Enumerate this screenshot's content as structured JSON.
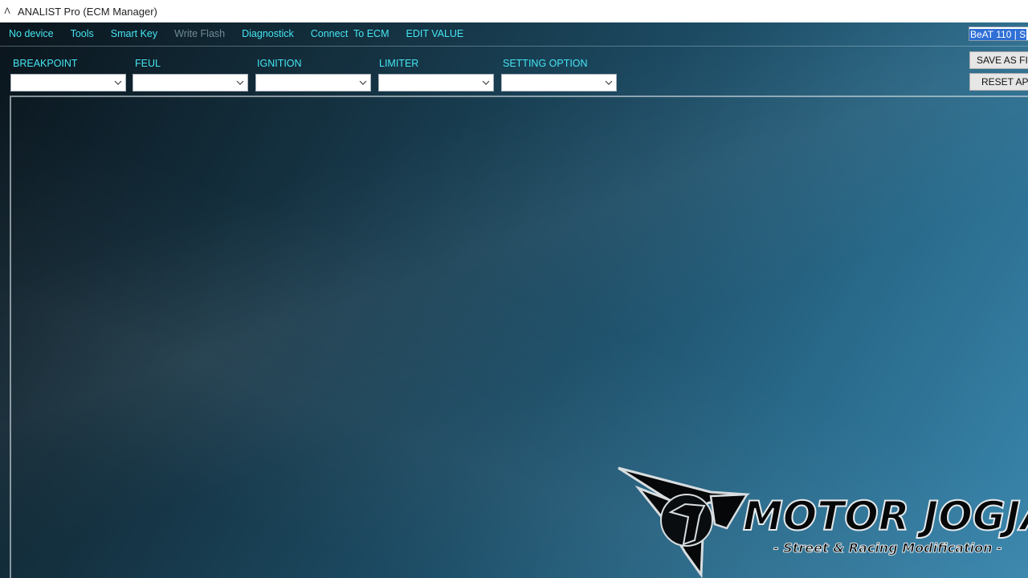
{
  "window": {
    "title": "ANALIST Pro (ECM Manager)",
    "icon": "app-icon"
  },
  "menu": {
    "items": [
      {
        "label": "No device",
        "enabled": true
      },
      {
        "label": "Tools",
        "enabled": true
      },
      {
        "label": "Smart Key",
        "enabled": true
      },
      {
        "label": "Write Flash",
        "enabled": false
      },
      {
        "label": "Diagnostick",
        "enabled": true
      },
      {
        "label": "Connect  To ECM",
        "enabled": true
      },
      {
        "label": "EDIT VALUE",
        "enabled": true
      }
    ],
    "model_field_value": "BeAT 110 | S",
    "accent_color": "#44e6f2"
  },
  "selectors": [
    {
      "label": "BREAKPOINT",
      "value": ""
    },
    {
      "label": "FEUL",
      "value": ""
    },
    {
      "label": "IGNITION",
      "value": ""
    },
    {
      "label": "LIMITER",
      "value": ""
    },
    {
      "label": "SETTING OPTION",
      "value": ""
    }
  ],
  "buttons": {
    "save_as": "SAVE AS FI",
    "reset": "RESET AP"
  },
  "watermark": {
    "brand": "MOTOR JOGJA",
    "tagline": "- Street & Racing Modification -"
  }
}
